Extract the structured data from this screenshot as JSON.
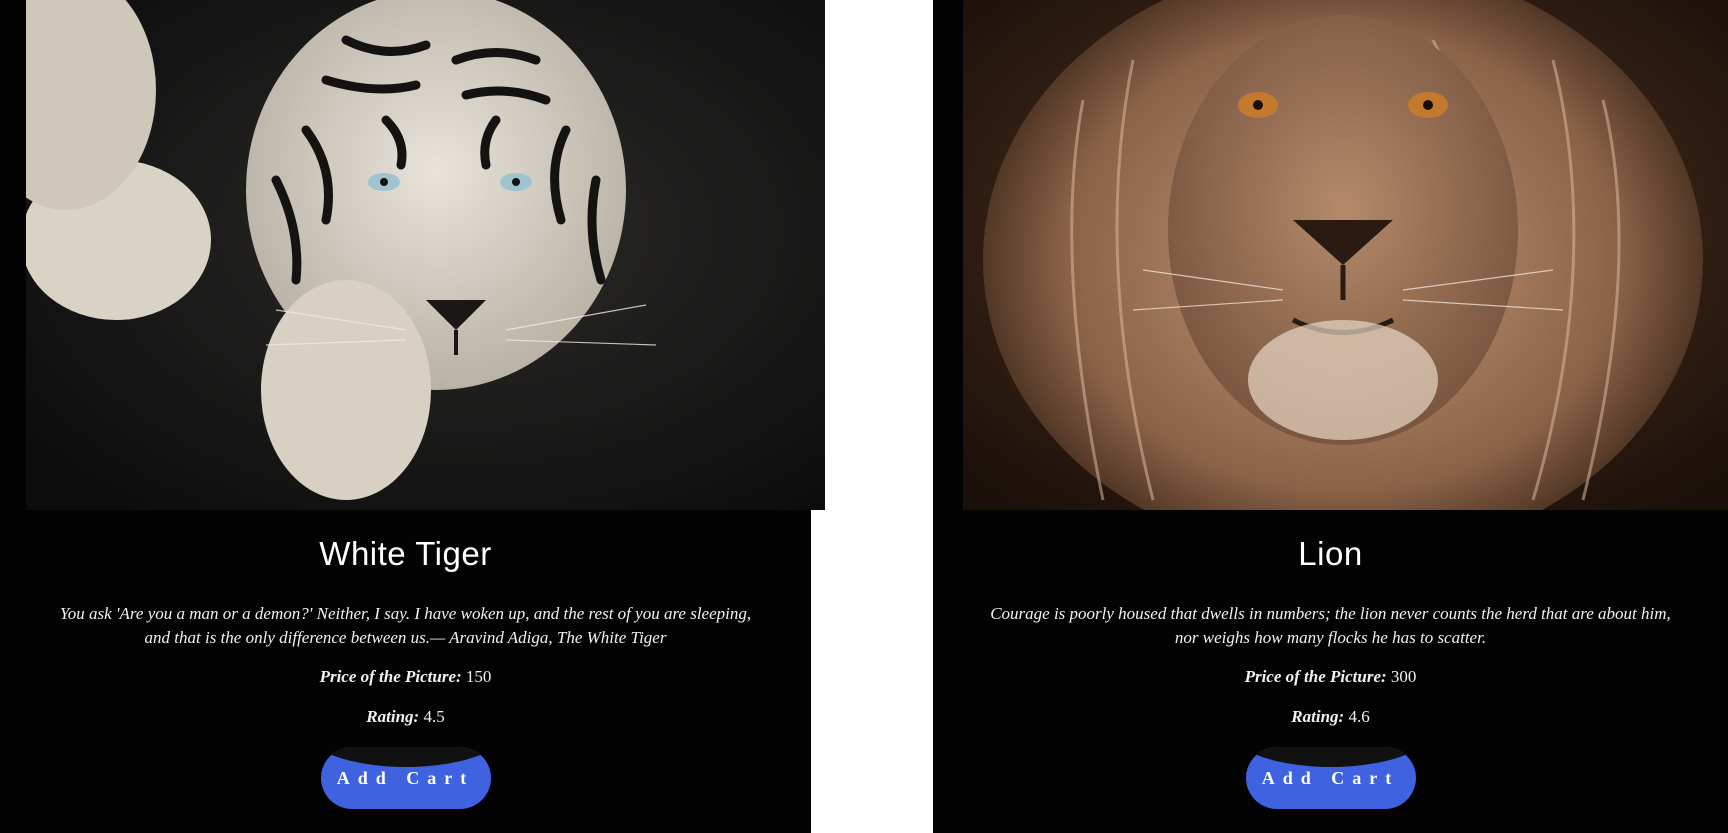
{
  "cards": [
    {
      "title": "White Tiger",
      "image_subject": "white tiger photo",
      "quote": "You ask 'Are you a man or a demon?' Neither, I say. I have woken up, and the rest of you are sleeping, and that is the only difference between us.— Aravind Adiga, The White Tiger",
      "price_label": "Price of the Picture:",
      "price_value": "150",
      "rating_label": "Rating:",
      "rating_value": "4.5",
      "button_label": "Add Cart"
    },
    {
      "title": "Lion",
      "image_subject": "lion photo",
      "quote": "Courage is poorly housed that dwells in numbers; the lion never counts the herd that are about him, nor weighs how many flocks he has to scatter.",
      "price_label": "Price of the Picture:",
      "price_value": "300",
      "rating_label": "Rating:",
      "rating_value": "4.6",
      "button_label": "Add Cart"
    }
  ],
  "colors": {
    "card_background": "#030303",
    "button_blue": "#3f63e0",
    "page_background": "#ffffff"
  }
}
